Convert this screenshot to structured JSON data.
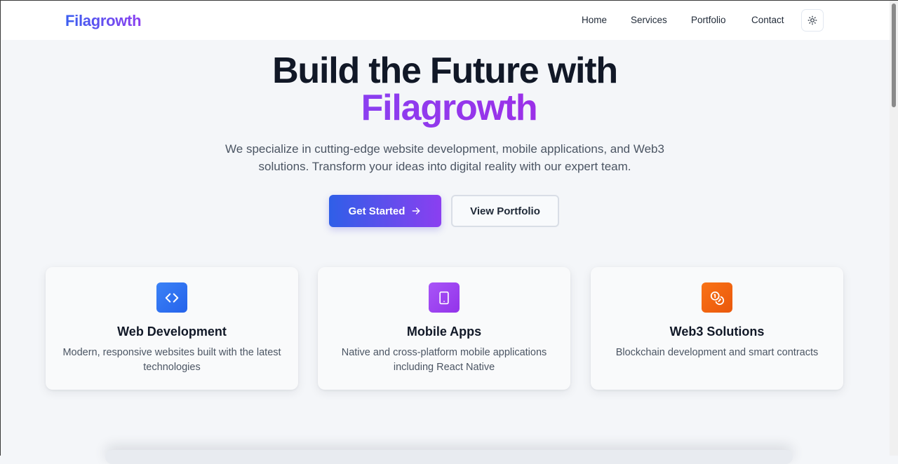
{
  "brand": "Filagrowth",
  "nav": {
    "items": [
      "Home",
      "Services",
      "Portfolio",
      "Contact"
    ],
    "theme_toggle_icon": "sun-icon"
  },
  "hero": {
    "title_line1": "Build the Future with",
    "title_line2": "Filagrowth",
    "subtitle": "We specialize in cutting-edge website development, mobile applications, and Web3 solutions. Transform your ideas into digital reality with our expert team.",
    "primary_button": "Get Started",
    "secondary_button": "View Portfolio"
  },
  "services": [
    {
      "title": "Web Development",
      "description": "Modern, responsive websites built with the latest technologies",
      "icon": "code-icon",
      "color": "#2f6fec"
    },
    {
      "title": "Mobile Apps",
      "description": "Native and cross-platform mobile applications including React Native",
      "icon": "tablet-icon",
      "color": "#9a3ae8"
    },
    {
      "title": "Web3 Solutions",
      "description": "Blockchain development and smart contracts",
      "icon": "coins-icon",
      "color": "#f26a12"
    }
  ],
  "colors": {
    "brand_blue": "#3b5ff0",
    "brand_purple": "#8b3ff0",
    "background": "#f4f6f9"
  }
}
